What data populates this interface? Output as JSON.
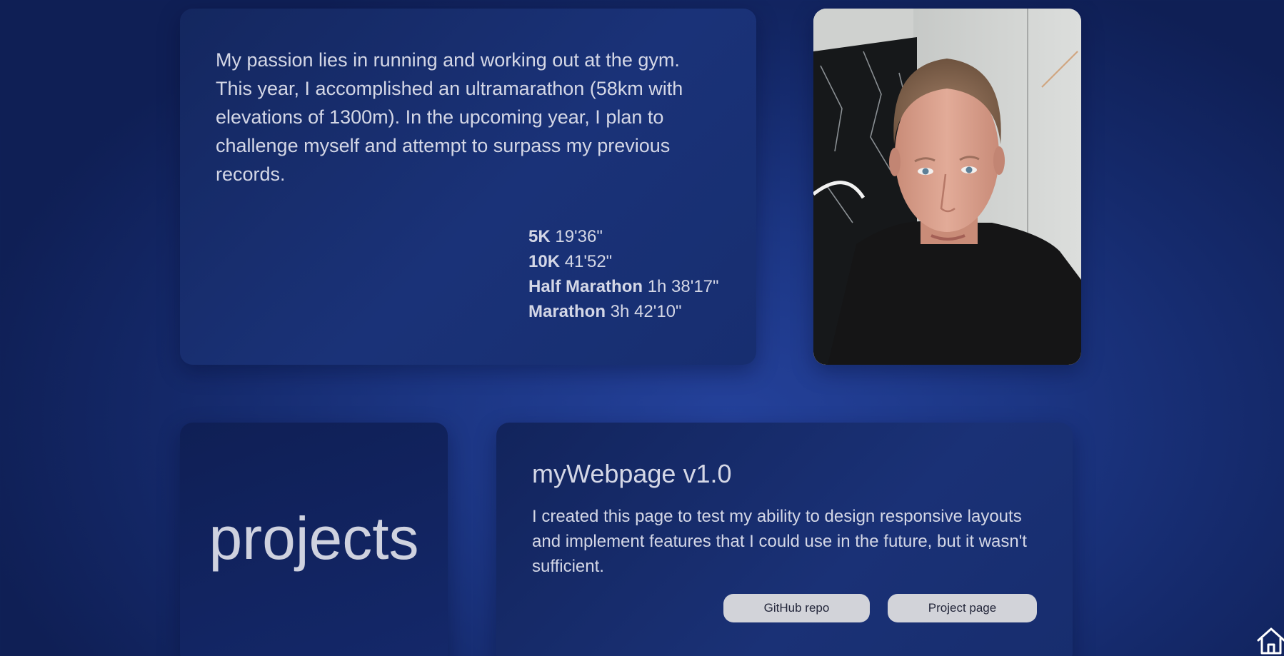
{
  "about": {
    "text": "My passion lies in running and working out at the gym. This year, I accomplished an ultramarathon (58km with elevations of 1300m). In the upcoming year, I plan to challenge myself and attempt to surpass my previous records.",
    "records": [
      {
        "label": "5K",
        "time": "19'36\""
      },
      {
        "label": "10K",
        "time": "41'52\""
      },
      {
        "label": "Half Marathon",
        "time": "1h 38'17\""
      },
      {
        "label": "Marathon",
        "time": "3h 42'10\""
      }
    ]
  },
  "projects_section": {
    "heading": "projects"
  },
  "project": {
    "title": "myWebpage v1.0",
    "description": "I created this page to test my ability to design responsive layouts and implement features that I could use in the future, but it wasn't sufficient.",
    "github_button": "GitHub repo",
    "page_button": "Project page"
  },
  "icons": {
    "home": "home-icon"
  },
  "colors": {
    "background": "#1c3684",
    "card": "#14275f",
    "button": "#d2d3d9",
    "text": "#d4d7e6"
  }
}
